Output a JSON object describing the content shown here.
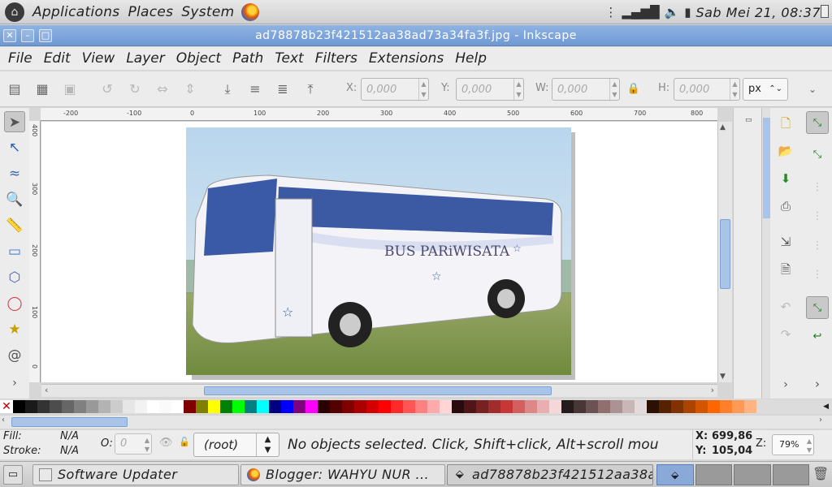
{
  "top_panel": {
    "menus": [
      "Applications",
      "Places",
      "System"
    ],
    "clock": "Sab Mei 21, 08:37"
  },
  "window": {
    "title": "ad78878b23f421512aa38ad73a34fa3f.jpg - Inkscape"
  },
  "menubar": [
    "File",
    "Edit",
    "View",
    "Layer",
    "Object",
    "Path",
    "Text",
    "Filters",
    "Extensions",
    "Help"
  ],
  "toolbar": {
    "x_label": "X:",
    "x_value": "0,000",
    "y_label": "Y:",
    "y_value": "0,000",
    "w_label": "W:",
    "w_value": "0,000",
    "h_label": "H:",
    "h_value": "0,000",
    "unit": "px"
  },
  "ruler": {
    "h_ticks": [
      "-200",
      "-100",
      "0",
      "100",
      "200",
      "300",
      "400",
      "500",
      "600",
      "700",
      "800"
    ],
    "v_ticks": [
      "400",
      "300",
      "200",
      "100",
      "0"
    ]
  },
  "canvas": {
    "image_text": "BUS PARiWISATA"
  },
  "palette": {
    "colors": [
      "#000000",
      "#1a1a1a",
      "#333333",
      "#4d4d4d",
      "#666666",
      "#808080",
      "#999999",
      "#b3b3b3",
      "#cccccc",
      "#e6e6e6",
      "#f2f2f2",
      "#ffffff",
      "#fafafa",
      "#ffffff",
      "#800000",
      "#808000",
      "#ffff00",
      "#008000",
      "#00ff00",
      "#008080",
      "#00ffff",
      "#000080",
      "#0000ff",
      "#800080",
      "#ff00ff",
      "#2b0000",
      "#550000",
      "#800000",
      "#aa0000",
      "#d40000",
      "#ff0000",
      "#ff2a2a",
      "#ff5555",
      "#ff8080",
      "#ffaaaa",
      "#ffd5d5",
      "#280b0b",
      "#501616",
      "#782121",
      "#a02c2c",
      "#c83737",
      "#d35f5f",
      "#de8787",
      "#e9afaf",
      "#f4d7d7",
      "#241c1c",
      "#483737",
      "#6c5353",
      "#916f6f",
      "#ac9393",
      "#c8b7b7",
      "#e3dbdb",
      "#2b1100",
      "#552200",
      "#803300",
      "#aa4400",
      "#d45500",
      "#ff6600",
      "#ff7f2a",
      "#ff9955",
      "#ffb380"
    ]
  },
  "status": {
    "fill_label": "Fill:",
    "fill_value": "N/A",
    "stroke_label": "Stroke:",
    "stroke_value": "N/A",
    "opacity_label": "O:",
    "opacity_value": "0",
    "layer": "(root)",
    "message": "No objects selected. Click, Shift+click, Alt+scroll mou",
    "x_label": "X:",
    "x_value": "699,86",
    "y_label": "Y:",
    "y_value": "105,04",
    "zoom_label": "Z:",
    "zoom_value": "79%"
  },
  "taskbar": {
    "items": [
      "Software Updater",
      "Blogger: WAHYU NUR ...",
      "ad78878b23f421512aa38a..."
    ]
  }
}
